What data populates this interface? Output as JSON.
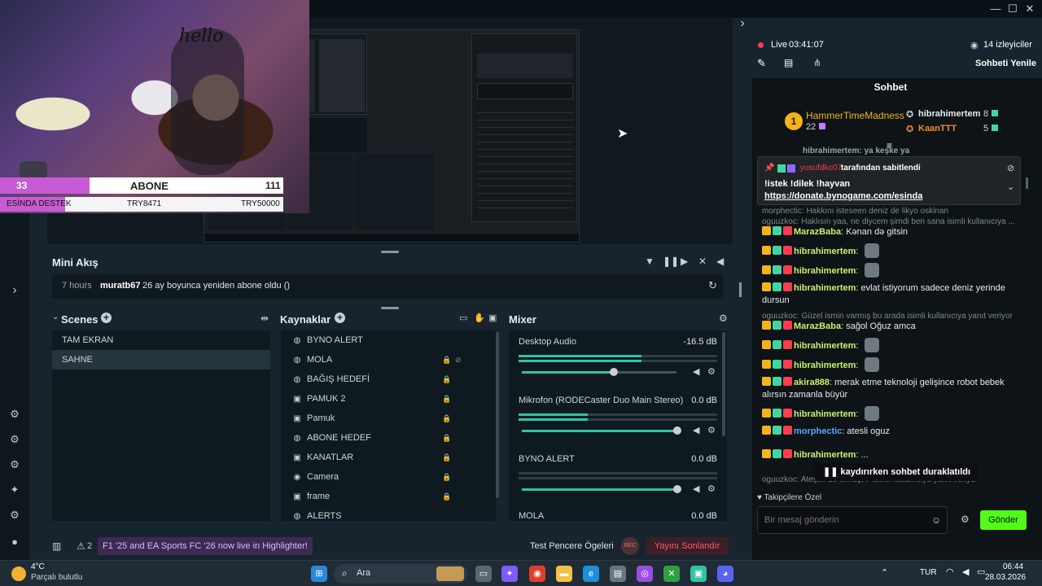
{
  "window": {
    "close_glyph": "✕",
    "max_glyph": "☐",
    "min_glyph": "—",
    "collapse_glyph": "›"
  },
  "overlay": {
    "hello_text": "hello",
    "abone_count": "33",
    "abone_label": "ABONE",
    "abone_goal": "111",
    "destek_label": "ESİNDA DESTEK",
    "destek_current": "TRY8471",
    "destek_goal": "TRY50000"
  },
  "mini_akis": {
    "title": "Mini Akış",
    "event_time": "7 hours",
    "event_user": "muratb67",
    "event_text": "26 ay boyunca yeniden abone oldu ()"
  },
  "scenes": {
    "title": "Scenes",
    "items": [
      {
        "label": "TAM EKRAN"
      },
      {
        "label": "SAHNE"
      }
    ]
  },
  "sources": {
    "title": "Kaynaklar",
    "items": [
      {
        "label": "BYNO ALERT",
        "icon": "globe-icon"
      },
      {
        "label": "MOLA",
        "icon": "globe-icon"
      },
      {
        "label": "BAĞIŞ HEDEFİ",
        "icon": "globe-icon"
      },
      {
        "label": "PAMUK 2",
        "icon": "image-icon"
      },
      {
        "label": "Pamuk",
        "icon": "image-icon"
      },
      {
        "label": "ABONE HEDEF",
        "icon": "globe-icon"
      },
      {
        "label": "KANATLAR",
        "icon": "image-icon"
      },
      {
        "label": "Camera",
        "icon": "camera-icon"
      },
      {
        "label": "frame",
        "icon": "image-icon"
      },
      {
        "label": "ALERTS",
        "icon": "globe-icon"
      }
    ]
  },
  "mixer": {
    "title": "Mixer",
    "channels": [
      {
        "name": "Desktop Audio",
        "db": "-16.5 dB",
        "level": 0.62,
        "volume": 0.58
      },
      {
        "name": "Mikrofon (RODECaster Duo Main Stereo)",
        "db": "0.0 dB",
        "level": 0.35,
        "volume": 1.0
      },
      {
        "name": "BYNO ALERT",
        "db": "0.0 dB",
        "level": 0.0,
        "volume": 1.0
      },
      {
        "name": "MOLA",
        "db": "0.0 dB",
        "level": 0.0,
        "volume": 1.0
      }
    ]
  },
  "statusbar": {
    "notif_count": "2",
    "highlight_text": "F1 '25 and EA Sports FC '26 now live in Highlighter!",
    "test_label": "Test Pencere Ögeleri",
    "rec_label": "REC",
    "end_stream_label": "Yayını Sonlandır"
  },
  "chat": {
    "live_label": "Live",
    "live_time": "03:41:07",
    "viewers": "14 izleyiciler",
    "refresh_label": "Sohbeti Yenile",
    "header": "Sohbet",
    "top_gifter_name": "HammerTimeMadness",
    "top_gifter_count": "22",
    "top_gifter_rank": "1",
    "gifter2_name": "hibrahimertem",
    "gifter2_count": "8",
    "gifter3_name": "KaanTTT",
    "gifter3_count": "5",
    "cut_line": "hibrahimertem: ya keşke ya",
    "pinned_by": "yusufdko07",
    "pinned_suffix": "tarafından sabitlendi",
    "pinned_line1": "!istek !dilek !hayvan",
    "pinned_link": "https://donate.bynogame.com/esinda",
    "pinned_hidden": "morphectic: Hakkını isteseen deniz de likyo oskinan",
    "messages": [
      {
        "reply": "oguuzkoc: Haklısın yaa, ne diycem şimdi ben sana isimli kullanıcıya ...",
        "user": "MarazBaba",
        "color": "#c9f26a",
        "text": "Kənan də gitsin"
      },
      {
        "user": "hibrahimertem",
        "color": "#c9f26a",
        "text": ""
      },
      {
        "user": "hibrahimertem",
        "color": "#c9f26a",
        "text": ""
      },
      {
        "user": "hibrahimertem",
        "color": "#c9f26a",
        "text": "evlat istiyorum sadece deniz yerinde dursun"
      },
      {
        "reply": "oguuzkoc: Güzel ismin varmış bu arada isimli kullanıcıya yanıt veriyor",
        "user": "MarazBaba",
        "color": "#c9f26a",
        "text": "sağol Oğuz amca"
      },
      {
        "user": "hibrahimertem",
        "color": "#c9f26a",
        "text": ""
      },
      {
        "user": "hibrahimertem",
        "color": "#c9f26a",
        "text": ""
      },
      {
        "user": "akira888",
        "color": "#c9f26a",
        "text": "merak etme teknoloji gelişince robot bebek alırsın zamanla büyür"
      },
      {
        "user": "hibrahimertem",
        "color": "#c9f26a",
        "text": ""
      },
      {
        "user": "morphectic",
        "color": "#5aa6ff",
        "text": "atesli oguz"
      },
      {
        "reply": "oguuzkoc: Ateşim 38 olmuş, :/ isimli kullanıcıya yanıt veriyor",
        "user": "hibrahimertem",
        "color": "#c9f26a",
        "text": "..."
      }
    ],
    "bottom_reply": "oguuzkoc: Ateşim 38 olmuş, :/ isimli kullanıcıya yanıt veriyor",
    "paused_label": "kaydırırken sohbet duraklatıldı",
    "followers_label": "Takipçilere Özel",
    "input_placeholder": "Bir mesaj gönderin",
    "send_label": "Gönder"
  },
  "taskbar": {
    "temp": "4°C",
    "weather": "Parçalı bulutlu",
    "search_label": "Ara",
    "lang": "TUR",
    "time": "06:44",
    "date": "28.03.2026"
  }
}
